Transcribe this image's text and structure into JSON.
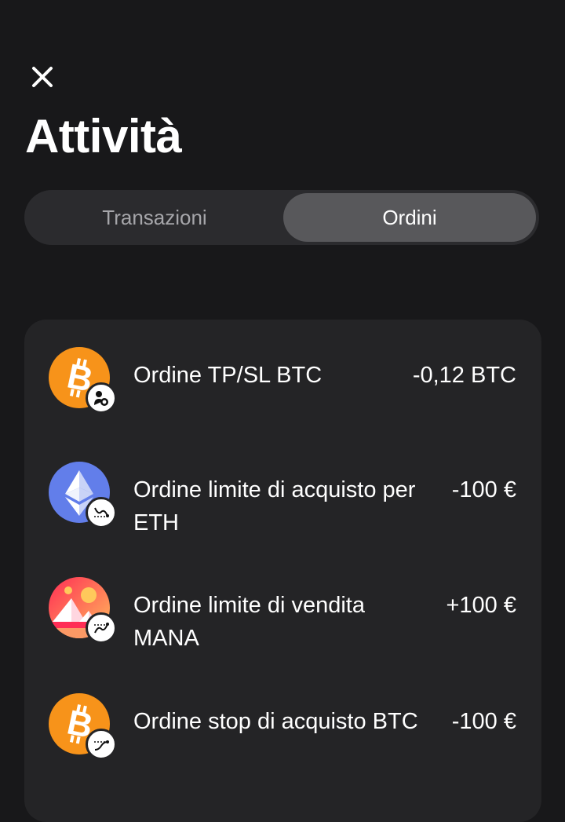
{
  "header": {
    "close_icon": "close-icon",
    "title": "Attività"
  },
  "tabs": [
    {
      "label": "Transazioni",
      "active": false
    },
    {
      "label": "Ordini",
      "active": true
    }
  ],
  "orders": [
    {
      "title": "Ordine TP/SL BTC",
      "amount": "-0,12 BTC",
      "asset_icon": "bitcoin-icon",
      "badge_icon": "tp-sl-icon",
      "asset_color": "#f7931a"
    },
    {
      "title": "Ordine limite di acquisto per ETH",
      "amount": "-100 €",
      "asset_icon": "ethereum-icon",
      "badge_icon": "limit-buy-icon",
      "asset_color": "#627eea"
    },
    {
      "title": "Ordine limite di vendita MANA",
      "amount": "+100 €",
      "asset_icon": "decentraland-icon",
      "badge_icon": "limit-sell-icon",
      "asset_color": "#ff2d55"
    },
    {
      "title": "Ordine stop di acquisto BTC",
      "amount": "-100 €",
      "asset_icon": "bitcoin-icon",
      "badge_icon": "stop-buy-icon",
      "asset_color": "#f7931a"
    }
  ],
  "colors": {
    "background": "#18181a",
    "card": "#242426",
    "tab_active": "#58585b",
    "tab_track": "#2b2b2e"
  }
}
